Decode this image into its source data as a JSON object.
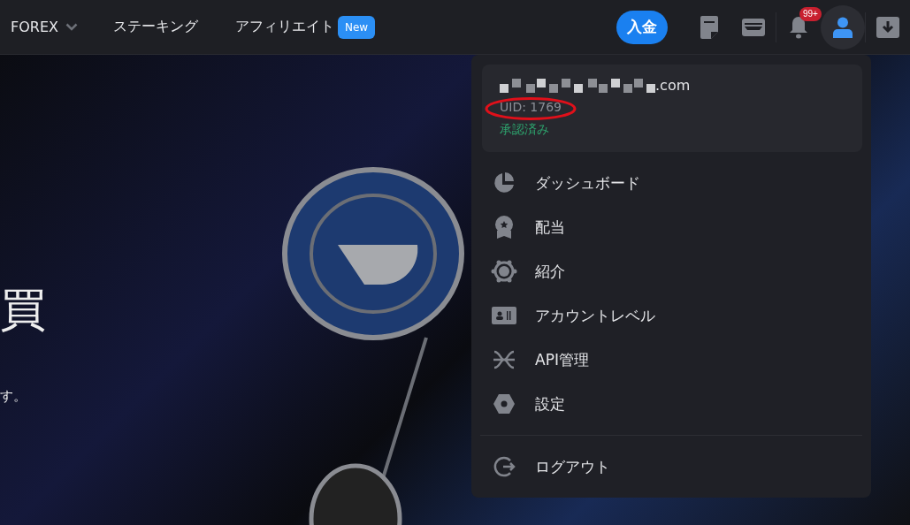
{
  "nav": {
    "items": [
      {
        "label": "FOREX",
        "kind": "dropdown"
      },
      {
        "label": "ステーキング",
        "kind": "link"
      },
      {
        "label": "アフィリエイト",
        "kind": "link",
        "badge": "New"
      }
    ]
  },
  "actions": {
    "deposit": "入金",
    "notification_count": "99+"
  },
  "hero": {
    "title": "買",
    "subtitle": "す。"
  },
  "account_menu": {
    "email": ".com",
    "uid": "UID: 1769",
    "status": "承認済み",
    "items": [
      {
        "label": "ダッシュボード"
      },
      {
        "label": "配当"
      },
      {
        "label": "紹介"
      },
      {
        "label": "アカウントレベル"
      },
      {
        "label": "API管理"
      },
      {
        "label": "設定"
      }
    ],
    "logout": "ログアウト"
  }
}
